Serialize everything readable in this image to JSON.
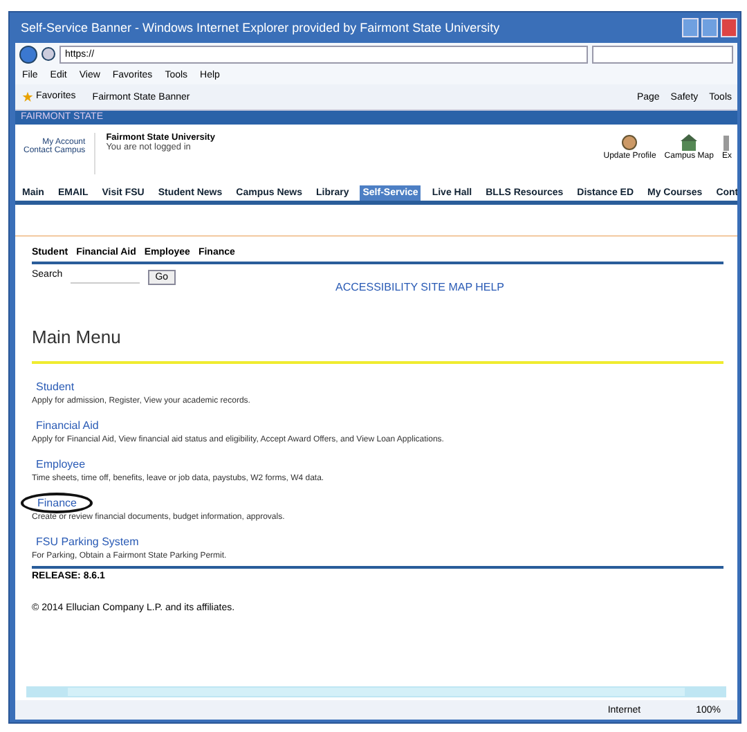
{
  "window": {
    "title": "Self-Service Banner - Windows Internet Explorer provided by Fairmont State University"
  },
  "address_bar": {
    "value": "https://"
  },
  "menu_bar": [
    "File",
    "Edit",
    "View",
    "Favorites",
    "Tools",
    "Help"
  ],
  "favorites_bar": {
    "label": "Favorites",
    "tab": "Fairmont State Banner"
  },
  "command_bar": [
    "Page",
    "Safety",
    "Tools"
  ],
  "site_bar": {
    "title": "FAIRMONT STATE"
  },
  "header": {
    "logo_lines": [
      "My Account",
      "Contact Campus"
    ],
    "title": "Fairmont State University",
    "subtitle": "You are not logged in",
    "icons": [
      {
        "label": "Update Profile",
        "kind": "hand"
      },
      {
        "label": "Campus Map",
        "kind": "building"
      },
      {
        "label": "Ex",
        "kind": "exit"
      }
    ]
  },
  "tabs": [
    {
      "label": "Main",
      "selected": false
    },
    {
      "label": "EMAIL",
      "selected": false
    },
    {
      "label": "Visit FSU",
      "selected": false
    },
    {
      "label": "Student News",
      "selected": false
    },
    {
      "label": "Campus News",
      "selected": false
    },
    {
      "label": "Library",
      "selected": false
    },
    {
      "label": "Self-Service",
      "selected": true
    },
    {
      "label": "Live Hall",
      "selected": false
    },
    {
      "label": "BLLS Resources",
      "selected": false
    },
    {
      "label": "Distance ED",
      "selected": false
    },
    {
      "label": "My Courses",
      "selected": false
    },
    {
      "label": "Cont",
      "selected": false
    }
  ],
  "sub_tabs": [
    "Student",
    "Financial Aid",
    "Employee",
    "Finance"
  ],
  "search": {
    "label": "Search",
    "button": "Go"
  },
  "site_links": "ACCESSIBILITY SITE MAP HELP",
  "page_title": "Main Menu",
  "menu_items": [
    {
      "link": "Student",
      "description": "Apply for admission, Register, View your academic records.",
      "circled": false
    },
    {
      "link": "Financial Aid",
      "description": "Apply for Financial Aid, View financial aid status and eligibility, Accept Award Offers, and View Loan Applications.",
      "circled": false
    },
    {
      "link": "Employee",
      "description": "Time sheets, time off, benefits, leave or job data, paystubs, W2 forms, W4 data.",
      "circled": false
    },
    {
      "link": "Finance",
      "description": "Create or review financial documents, budget information, approvals.",
      "circled": true
    },
    {
      "link": "FSU Parking System",
      "description": "For Parking, Obtain a Fairmont State Parking Permit.",
      "circled": false
    }
  ],
  "release": "RELEASE: 8.6.1",
  "copyright": "© 2014 Ellucian Company L.P. and its affiliates.",
  "status_bar": {
    "zone": "Internet",
    "zoom": "100%"
  }
}
